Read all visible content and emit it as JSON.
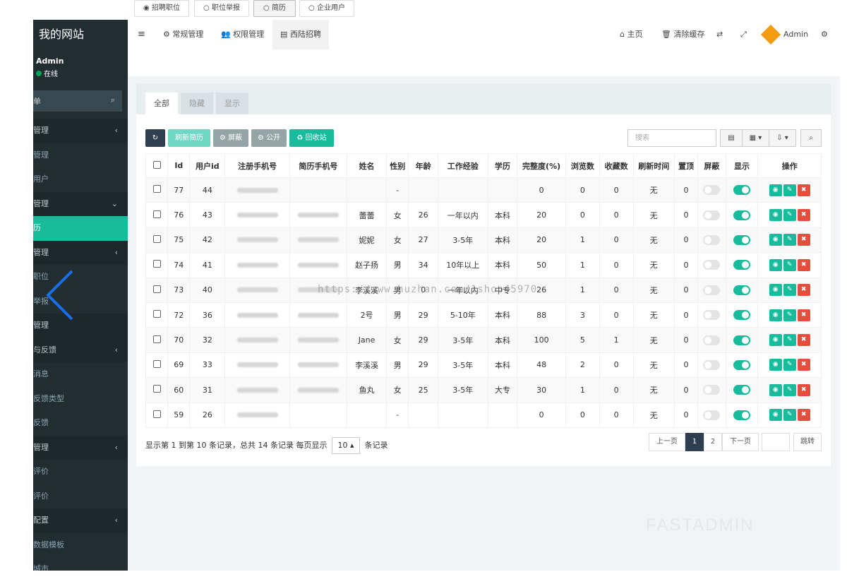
{
  "sidebar": {
    "brand": "我的网站",
    "user_name": "Admin",
    "user_status": "在线",
    "search_placeholder": "单",
    "menu": [
      {
        "label": "管理",
        "kind": "head",
        "arrow": "‹"
      },
      {
        "label": "管理",
        "kind": "sub"
      },
      {
        "label": "用户",
        "kind": "sub"
      },
      {
        "label": "管理",
        "kind": "head",
        "arrow": "⌄"
      },
      {
        "label": "历",
        "kind": "active"
      },
      {
        "label": "管理",
        "kind": "head",
        "arrow": "‹"
      },
      {
        "label": "职位",
        "kind": "sub"
      },
      {
        "label": "举报",
        "kind": "sub"
      },
      {
        "label": "管理",
        "kind": "head"
      },
      {
        "label": "与反馈",
        "kind": "head",
        "arrow": "‹"
      },
      {
        "label": "消息",
        "kind": "sub"
      },
      {
        "label": "反馈类型",
        "kind": "sub"
      },
      {
        "label": "反馈",
        "kind": "sub"
      },
      {
        "label": "管理",
        "kind": "head",
        "arrow": "‹"
      },
      {
        "label": "评价",
        "kind": "sub"
      },
      {
        "label": "评价",
        "kind": "sub"
      },
      {
        "label": "配置",
        "kind": "head",
        "arrow": "‹"
      },
      {
        "label": "数据模板",
        "kind": "sub"
      },
      {
        "label": "城市",
        "kind": "sub"
      }
    ]
  },
  "topbar": {
    "menu_toggle_icon": "≡",
    "nav": [
      "常规管理",
      "权限管理",
      "西陆招聘"
    ],
    "right": {
      "home": "主页",
      "clear_cache": "清除缓存",
      "admin": "Admin"
    }
  },
  "subtabs": [
    "招聘职位",
    "职位举报",
    "简历",
    "企业用户"
  ],
  "panel_tabs": [
    "全部",
    "隐藏",
    "显示"
  ],
  "toolbar": {
    "refresh_icon": "↻",
    "refresh_resume": "刷新简历",
    "shield": "屏蔽",
    "publish": "公开",
    "recycle": "回收站",
    "search_placeholder": "搜索"
  },
  "table": {
    "headers": [
      "Id",
      "用户id",
      "注册手机号",
      "简历手机号",
      "姓名",
      "性别",
      "年龄",
      "工作经验",
      "学历",
      "完整度(%)",
      "浏览数",
      "收藏数",
      "刷新时间",
      "置顶",
      "屏蔽",
      "显示",
      "操作"
    ],
    "rows": [
      {
        "id": "77",
        "uid": "44",
        "reg": true,
        "res": false,
        "name": "",
        "sex": "-",
        "age": "",
        "exp": "",
        "edu": "",
        "comp": "0",
        "views": "0",
        "favs": "0",
        "refresh": "无",
        "top": "0"
      },
      {
        "id": "76",
        "uid": "43",
        "reg": true,
        "res": true,
        "name": "蕾蕾",
        "sex": "女",
        "age": "26",
        "exp": "一年以内",
        "edu": "本科",
        "comp": "20",
        "views": "0",
        "favs": "0",
        "refresh": "无",
        "top": "0"
      },
      {
        "id": "75",
        "uid": "42",
        "reg": true,
        "res": true,
        "name": "妮妮",
        "sex": "女",
        "age": "27",
        "exp": "3-5年",
        "edu": "本科",
        "comp": "20",
        "views": "1",
        "favs": "0",
        "refresh": "无",
        "top": "0"
      },
      {
        "id": "74",
        "uid": "41",
        "reg": true,
        "res": true,
        "name": "赵子扬",
        "sex": "男",
        "age": "34",
        "exp": "10年以上",
        "edu": "本科",
        "comp": "50",
        "views": "1",
        "favs": "0",
        "refresh": "无",
        "top": "0"
      },
      {
        "id": "73",
        "uid": "40",
        "reg": true,
        "res": true,
        "name": "李溪溪",
        "sex": "男",
        "age": "0",
        "exp": "一年以内",
        "edu": "中专",
        "comp": "26",
        "views": "1",
        "favs": "0",
        "refresh": "无",
        "top": "0"
      },
      {
        "id": "72",
        "uid": "36",
        "reg": true,
        "res": true,
        "name": "2号",
        "sex": "男",
        "age": "29",
        "exp": "5-10年",
        "edu": "本科",
        "comp": "88",
        "views": "3",
        "favs": "0",
        "refresh": "无",
        "top": "0"
      },
      {
        "id": "70",
        "uid": "32",
        "reg": true,
        "res": true,
        "name": "Jane",
        "sex": "女",
        "age": "29",
        "exp": "3-5年",
        "edu": "本科",
        "comp": "100",
        "views": "5",
        "favs": "1",
        "refresh": "无",
        "top": "0"
      },
      {
        "id": "69",
        "uid": "33",
        "reg": true,
        "res": true,
        "name": "李溪溪",
        "sex": "男",
        "age": "29",
        "exp": "3-5年",
        "edu": "本科",
        "comp": "48",
        "views": "2",
        "favs": "0",
        "refresh": "无",
        "top": "0"
      },
      {
        "id": "60",
        "uid": "31",
        "reg": true,
        "res": true,
        "name": "鱼丸",
        "sex": "女",
        "age": "25",
        "exp": "3-5年",
        "edu": "大专",
        "comp": "30",
        "views": "1",
        "favs": "0",
        "refresh": "无",
        "top": "0"
      },
      {
        "id": "59",
        "uid": "26",
        "reg": true,
        "res": false,
        "name": "",
        "sex": "-",
        "age": "",
        "exp": "",
        "edu": "",
        "comp": "0",
        "views": "0",
        "favs": "0",
        "refresh": "无",
        "top": "0"
      }
    ]
  },
  "pagination": {
    "info_prefix": "显示第 1 到第 10 条记录，总共 14 条记录 每页显示",
    "page_size": "10 ▴",
    "info_suffix": "条记录",
    "prev": "上一页",
    "pages": [
      "1",
      "2"
    ],
    "next": "下一页",
    "jump": "跳转"
  },
  "watermark": "https://www.huzhan.com/1shop45970",
  "logo_watermark": "FASTADMIN",
  "colors": {
    "accent": "#18bc9c",
    "sidebar": "#222d32",
    "danger": "#e74c3c",
    "dark": "#2c3e50",
    "back_arrow": "#1a6fe8"
  }
}
